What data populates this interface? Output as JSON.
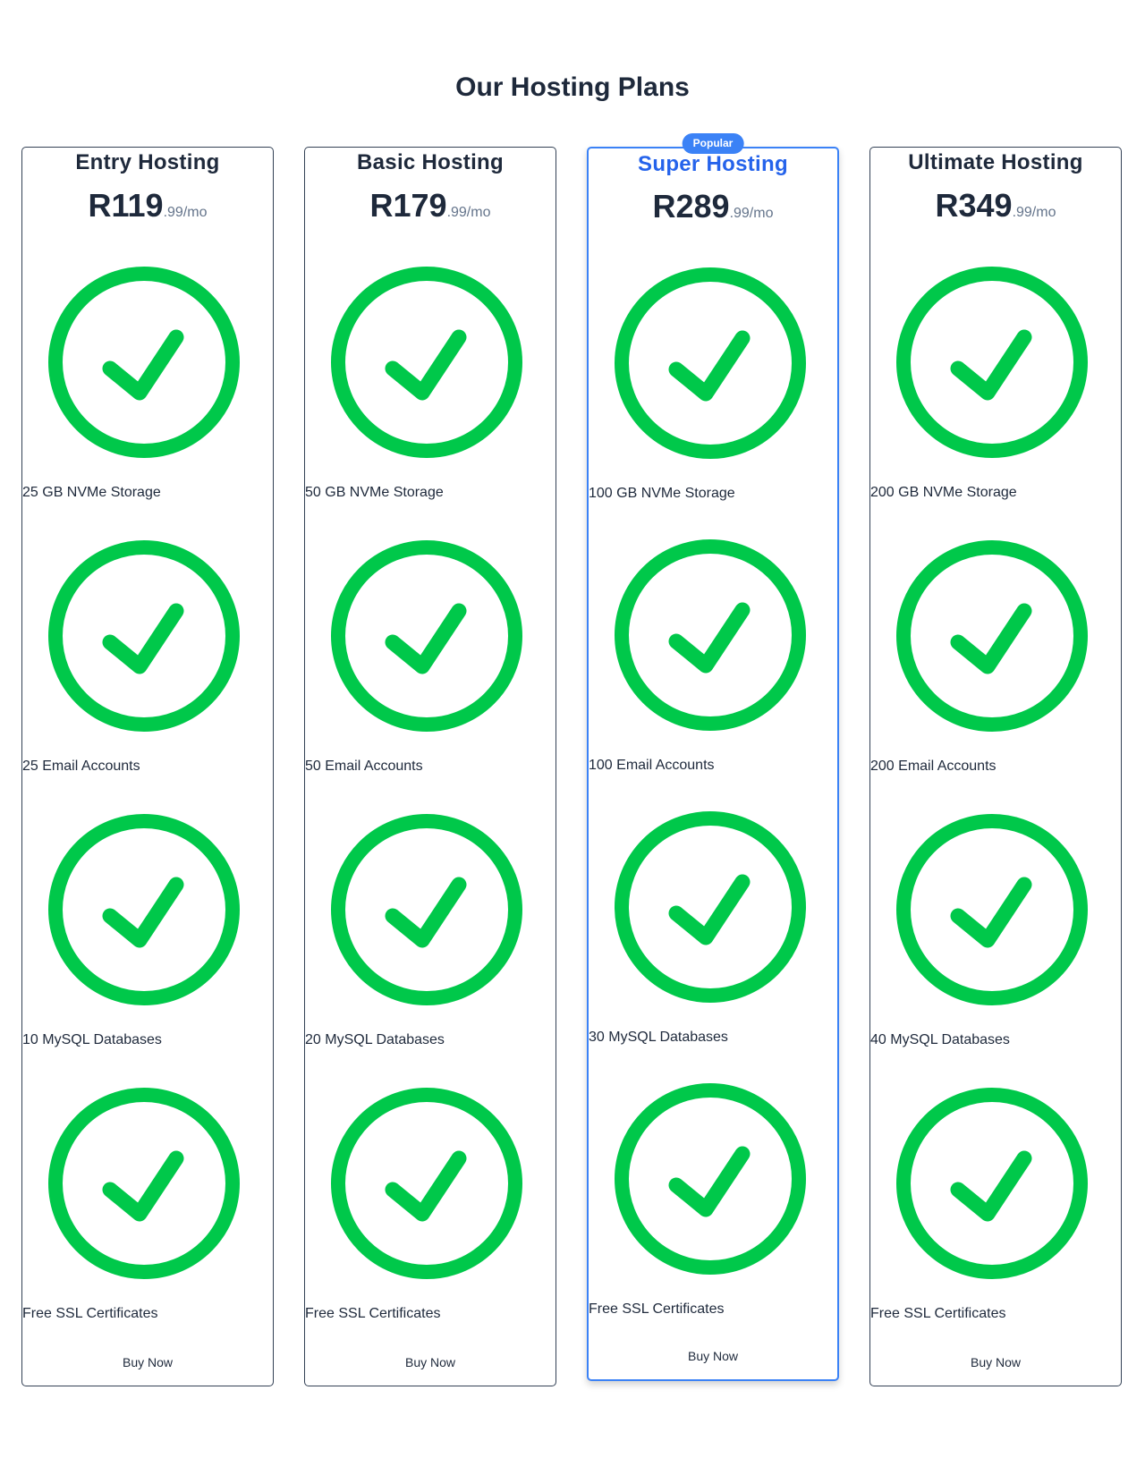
{
  "page": {
    "title": "Our Hosting Plans"
  },
  "colors": {
    "check": "#00c84a",
    "accent": "#3b82f6",
    "text": "#1e293b",
    "muted": "#64748b"
  },
  "plans": [
    {
      "name": "Entry Hosting",
      "price_main": "R119",
      "price_suffix": ".99/mo",
      "features": [
        {
          "icon": "check-circle-icon",
          "label": "25 GB NVMe Storage"
        },
        {
          "icon": "check-circle-icon",
          "label": "25 Email Accounts"
        },
        {
          "icon": "check-circle-icon",
          "label": "10 MySQL Databases"
        },
        {
          "icon": "check-circle-icon",
          "label": "Free SSL Certificates"
        }
      ],
      "button_label": "Buy Now"
    },
    {
      "name": "Basic Hosting",
      "price_main": "R179",
      "price_suffix": ".99/mo",
      "features": [
        {
          "icon": "check-circle-icon",
          "label": "50 GB NVMe Storage"
        },
        {
          "icon": "check-circle-icon",
          "label": "50 Email Accounts"
        },
        {
          "icon": "check-circle-icon",
          "label": "20 MySQL Databases"
        },
        {
          "icon": "check-circle-icon",
          "label": "Free SSL Certificates"
        }
      ],
      "button_label": "Buy Now"
    },
    {
      "name": "Super Hosting",
      "badge": "Popular",
      "price_main": "R289",
      "price_suffix": ".99/mo",
      "features": [
        {
          "icon": "check-circle-icon",
          "label": "100 GB NVMe Storage"
        },
        {
          "icon": "check-circle-icon",
          "label": "100 Email Accounts"
        },
        {
          "icon": "check-circle-icon",
          "label": "30 MySQL Databases"
        },
        {
          "icon": "check-circle-icon",
          "label": "Free SSL Certificates"
        }
      ],
      "button_label": "Buy Now"
    },
    {
      "name": "Ultimate Hosting",
      "price_main": "R349",
      "price_suffix": ".99/mo",
      "features": [
        {
          "icon": "check-circle-icon",
          "label": "200 GB NVMe Storage"
        },
        {
          "icon": "check-circle-icon",
          "label": "200 Email Accounts"
        },
        {
          "icon": "check-circle-icon",
          "label": "40 MySQL Databases"
        },
        {
          "icon": "check-circle-icon",
          "label": "Free SSL Certificates"
        }
      ],
      "button_label": "Buy Now"
    }
  ]
}
